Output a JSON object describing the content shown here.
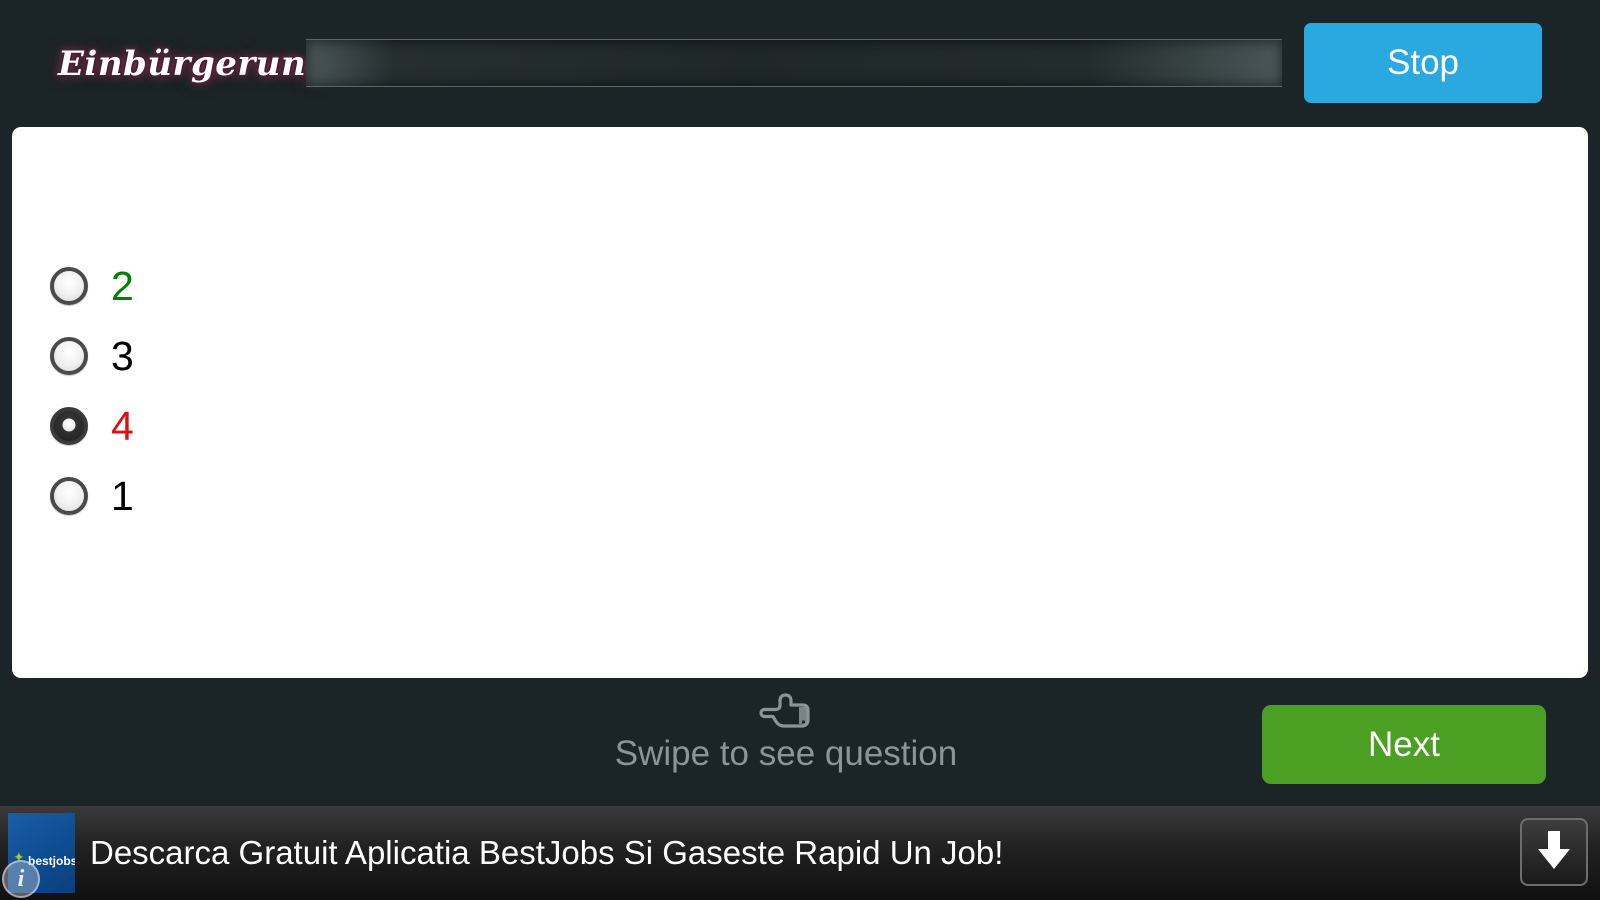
{
  "header": {
    "brand": "Einbürgerung",
    "progress": {
      "name": "quiz-progress-bar",
      "value_percent": 0,
      "label": ""
    },
    "stop_label": "Stop"
  },
  "card": {
    "question_text": "",
    "options": [
      {
        "label": "2",
        "color": "#008000",
        "selected": false,
        "state": "correct"
      },
      {
        "label": "3",
        "color": "#000000",
        "selected": false,
        "state": "neutral"
      },
      {
        "label": "4",
        "color": "#e01010",
        "selected": true,
        "state": "wrong"
      },
      {
        "label": "1",
        "color": "#000000",
        "selected": false,
        "state": "neutral"
      }
    ]
  },
  "footer": {
    "swipe_hint": "Swipe to see question",
    "hand_icon": "pointing-hand-left-icon",
    "next_label": "Next"
  },
  "ad": {
    "logo_text": "bestjobs",
    "logo_star": "✦",
    "info_badge": "i",
    "headline": "Descarca Gratuit Aplicatia BestJobs Si Gaseste Rapid Un Job!",
    "download_icon": "download-arrow-icon"
  },
  "colors": {
    "background": "#1b2426",
    "stop_blue": "#29a9e0",
    "next_green": "#4ba023",
    "correct_green": "#008000",
    "wrong_red": "#e01010",
    "hint_gray": "#8b9597",
    "card_white": "#ffffff"
  }
}
